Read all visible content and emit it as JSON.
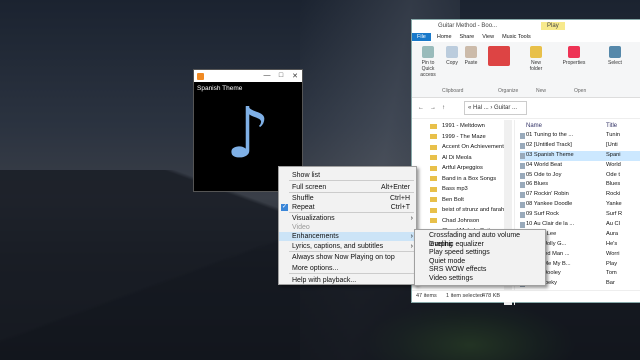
{
  "player": {
    "track_title": "Spanish Theme",
    "window_controls": [
      "—",
      "□",
      "✕"
    ],
    "icons": {
      "app": "media-player-icon",
      "art": "music-note-icon"
    },
    "note_glyph": "♪"
  },
  "context_menu": {
    "items": [
      {
        "label": "Show list",
        "shortcut": ""
      },
      {
        "label": "Full screen",
        "shortcut": "Alt+Enter"
      },
      {
        "label": "Shuffle",
        "shortcut": "Ctrl+H"
      },
      {
        "label": "Repeat",
        "shortcut": "Ctrl+T",
        "checked": true
      },
      {
        "label": "Visualizations",
        "shortcut": "",
        "submenu": true
      },
      {
        "label": "Video",
        "shortcut": "",
        "disabled": true
      },
      {
        "label": "Enhancements",
        "shortcut": "",
        "submenu": true,
        "highlighted": true
      },
      {
        "label": "Lyrics, captions, and subtitles",
        "shortcut": "",
        "submenu": true
      },
      {
        "label": "Always show Now Playing on top",
        "shortcut": ""
      },
      {
        "label": "More options...",
        "shortcut": ""
      },
      {
        "label": "Help with playback...",
        "shortcut": ""
      }
    ]
  },
  "enhancements_submenu": {
    "items": [
      "Crossfading and auto volume leveling",
      "Graphic equalizer",
      "Play speed settings",
      "Quiet mode",
      "SRS WOW effects",
      "Video settings"
    ]
  },
  "explorer": {
    "title": "Guitar Method - Boo...",
    "context_tab": "Play",
    "tabs": [
      "File",
      "Home",
      "Share",
      "View",
      "Music Tools"
    ],
    "ribbon": {
      "pin": "Pin to Quick access",
      "copy": "Copy",
      "paste": "Paste",
      "new_folder": "New folder",
      "properties": "Properties",
      "select": "Select",
      "groups": [
        "Clipboard",
        "Organize",
        "New",
        "Open"
      ]
    },
    "address": "« Hal ... › Guitar ...",
    "folders": [
      "1991 - Meltdown",
      "1999 - The Maze",
      "Accent On Achievement",
      "Al Di Meola",
      "Artful Arpeggios",
      "Band in a Box Songs",
      "Bass mp3",
      "Ben Bolt",
      "beist of strunz and farah",
      "Chad Johnson",
      "Chord Melody Guitar"
    ],
    "columns": {
      "name": "Name",
      "title": "Title"
    },
    "files": [
      {
        "name": "01 Tuning to the ...",
        "title": "Tunin"
      },
      {
        "name": "02 [Untitled Track]",
        "title": "[Unti"
      },
      {
        "name": "03 Spanish Theme",
        "title": "Spani",
        "selected": true
      },
      {
        "name": "04 World Beat",
        "title": "World"
      },
      {
        "name": "05 Ode to Joy",
        "title": "Ode t"
      },
      {
        "name": "06 Blues",
        "title": "Blues"
      },
      {
        "name": "07 Rockin' Robin",
        "title": "Rocki"
      },
      {
        "name": "08 Yankee Doodle",
        "title": "Yanke"
      },
      {
        "name": "09 Surf Rock",
        "title": "Surf R"
      },
      {
        "name": "10 Au Clair de la ...",
        "title": "Au Cl"
      },
      {
        "name": "11 Aura Lee",
        "title": "Aura"
      },
      {
        "name": "...e's a Jolly G...",
        "title": "He's"
      },
      {
        "name": "...Worried Man ...",
        "title": "Worri"
      },
      {
        "name": "...Play Me My B...",
        "title": "Play"
      },
      {
        "name": "...Tom Dooley",
        "title": "Tom"
      },
      {
        "name": "...Bar Boeky",
        "title": "Bar"
      }
    ],
    "status": {
      "items": "47 items",
      "selected": "1 item selected",
      "size": "478 KB"
    }
  }
}
